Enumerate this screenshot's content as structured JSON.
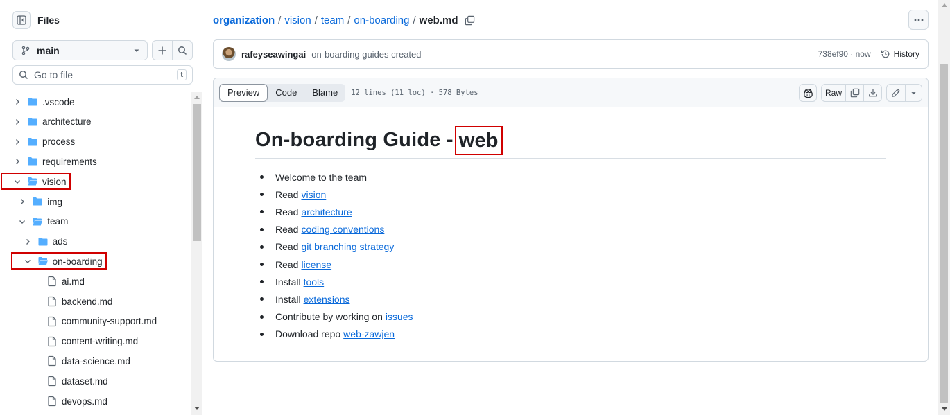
{
  "sidebar": {
    "title": "Files",
    "branch": "main",
    "goto_placeholder": "Go to file",
    "goto_shortcut": "t",
    "tree": [
      {
        "label": ".vscode",
        "type": "folder",
        "depth": 0,
        "expanded": false
      },
      {
        "label": "architecture",
        "type": "folder",
        "depth": 0,
        "expanded": false
      },
      {
        "label": "process",
        "type": "folder",
        "depth": 0,
        "expanded": false
      },
      {
        "label": "requirements",
        "type": "folder",
        "depth": 0,
        "expanded": false
      },
      {
        "label": "vision",
        "type": "folder",
        "depth": 0,
        "expanded": true,
        "highlighted": true
      },
      {
        "label": "img",
        "type": "folder",
        "depth": 1,
        "expanded": false
      },
      {
        "label": "team",
        "type": "folder",
        "depth": 1,
        "expanded": true
      },
      {
        "label": "ads",
        "type": "folder",
        "depth": 2,
        "expanded": false
      },
      {
        "label": "on-boarding",
        "type": "folder",
        "depth": 2,
        "expanded": true,
        "highlighted": true
      },
      {
        "label": "ai.md",
        "type": "file",
        "depth": 3
      },
      {
        "label": "backend.md",
        "type": "file",
        "depth": 3
      },
      {
        "label": "community-support.md",
        "type": "file",
        "depth": 3
      },
      {
        "label": "content-writing.md",
        "type": "file",
        "depth": 3
      },
      {
        "label": "data-science.md",
        "type": "file",
        "depth": 3
      },
      {
        "label": "dataset.md",
        "type": "file",
        "depth": 3
      },
      {
        "label": "devops.md",
        "type": "file",
        "depth": 3
      }
    ]
  },
  "breadcrumb": {
    "items": [
      "organization",
      "vision",
      "team",
      "on-boarding"
    ],
    "current": "web.md",
    "separator": "/"
  },
  "commit": {
    "author": "rafeyseawingai",
    "message": "on-boarding guides created",
    "meta": "738ef90 · now",
    "history_label": "History"
  },
  "file": {
    "tabs": [
      "Preview",
      "Code",
      "Blame"
    ],
    "active_tab": "Preview",
    "info": "12 lines (11 loc) · 578 Bytes",
    "raw_label": "Raw"
  },
  "markdown": {
    "title_prefix": "On-boarding Guide -",
    "title_highlight": "web",
    "items": [
      {
        "text": "Welcome to the team",
        "link": ""
      },
      {
        "text": "Read",
        "link": "vision"
      },
      {
        "text": "Read",
        "link": "architecture"
      },
      {
        "text": "Read",
        "link": "coding conventions"
      },
      {
        "text": "Read",
        "link": "git branching strategy"
      },
      {
        "text": "Read",
        "link": "license"
      },
      {
        "text": "Install",
        "link": "tools"
      },
      {
        "text": "Install",
        "link": "extensions"
      },
      {
        "text": "Contribute by working on",
        "link": "issues"
      },
      {
        "text": "Download repo",
        "link": "web-zawjen"
      }
    ]
  },
  "colors": {
    "link": "#0969da",
    "highlight_box": "#d00000",
    "folder": "#54aeff",
    "border": "#d1d9e0"
  }
}
